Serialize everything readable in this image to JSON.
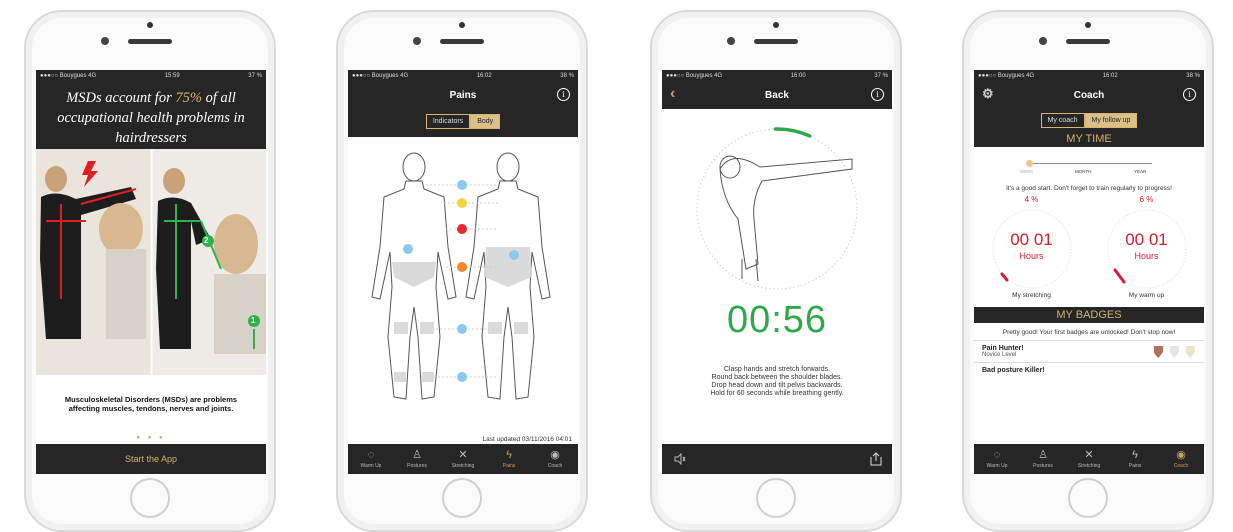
{
  "phone1": {
    "status": {
      "carrier": "●●●○○ Bouygues  4G",
      "time": "15:59",
      "battery": "37 %"
    },
    "headline": {
      "text_a": "MSDs account for ",
      "highlight": "75%",
      "text_b": " of all occupational health problems in hairdressers"
    },
    "caption": "Musculoskeletal Disorders (MSDs) are problems affecting muscles, tendons, nerves and joints.",
    "dots": "● ● ●",
    "markers": [
      "2",
      "1"
    ],
    "start_button": "Start the App"
  },
  "phone2": {
    "status": {
      "carrier": "●●●○○ Bouygues  4G",
      "time": "16:02",
      "battery": "38 %"
    },
    "title": "Pains",
    "info": "i",
    "segments": [
      "Indicators",
      "Body"
    ],
    "active_segment": "Body",
    "last_updated": "Last updated 03/11/2016 04:01",
    "tabs": [
      {
        "label": "Warm Up",
        "icon": "◌"
      },
      {
        "label": "Postures",
        "icon": "♙"
      },
      {
        "label": "Stretching",
        "icon": "✕"
      },
      {
        "label": "Pains",
        "icon": "ϟ"
      },
      {
        "label": "Coach",
        "icon": "◉"
      }
    ],
    "active_tab": "Pains"
  },
  "phone3": {
    "status": {
      "carrier": "●●●○○ Bouygues  4G",
      "time": "16:00",
      "battery": "37 %"
    },
    "title": "Back",
    "info": "i",
    "back": "‹",
    "timer": "00:56",
    "instructions": [
      "Clasp hands and stretch forwards.",
      "Round back between the shoulder blades.",
      "Drop head down and tilt pelvis backwards.",
      "Hold for 60 seconds while breathing gently."
    ],
    "progress_fraction": 0.07,
    "colors": {
      "timer": "#2ea84a"
    }
  },
  "phone4": {
    "status": {
      "carrier": "●●●○○ Bouygues  4G",
      "time": "16:02",
      "battery": "38 %"
    },
    "title": "Coach",
    "info": "i",
    "gear": "⚙",
    "segments": [
      "My coach",
      "My follow up"
    ],
    "active_segment": "My follow up",
    "my_time_heading": "MY TIME",
    "periods": [
      "WEEK",
      "MONTH",
      "YEAR"
    ],
    "encouragement": "It's a good start. Don't forget to train regularly to progress!",
    "gauges": [
      {
        "percent": "4 %",
        "value": "00 01",
        "unit": "Hours",
        "label": "My stretching"
      },
      {
        "percent": "6 %",
        "value": "00 01",
        "unit": "Hours",
        "label": "My warm up"
      }
    ],
    "badges_heading": "MY BADGES",
    "badges_text": "Pretty good! Your first badges are unlocked! Don't stop now!",
    "badges": [
      {
        "name": "Pain Hunter!",
        "level": "Novice Level"
      },
      {
        "name": "Bad posture Killer!",
        "level": ""
      }
    ],
    "active_tab": "Coach",
    "colors": {
      "gauge": "#d21f2e",
      "gold": "#d6b26a"
    }
  }
}
